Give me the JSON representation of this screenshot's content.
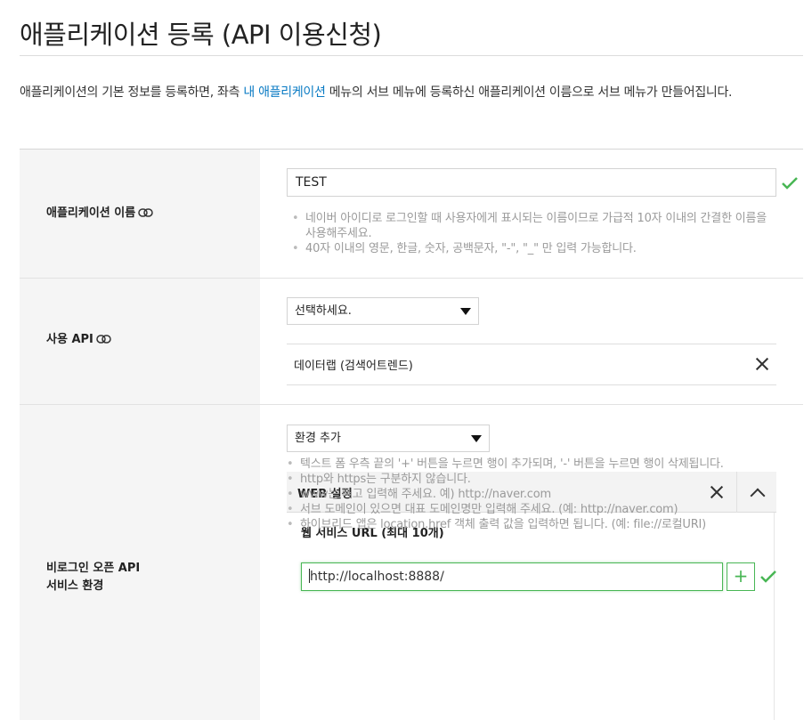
{
  "page": {
    "title": "애플리케이션 등록 (API 이용신청)",
    "description_before": "애플리케이션의 기본 정보를 등록하면, 좌측 ",
    "description_link": "내 애플리케이션",
    "description_after": " 메뉴의 서브 메뉴에 등록하신 애플리케이션 이름으로 서브 메뉴가 만들어집니다."
  },
  "app_name": {
    "label": "애플리케이션 이름",
    "value": "TEST",
    "hints": [
      "네이버 아이디로 로그인할 때 사용자에게 표시되는 이름이므로 가급적 10자 이내의 간결한 이름을 사용해주세요.",
      "40자 이내의 영문, 한글, 숫자, 공백문자, \"-\", \"_\" 만 입력 가능합니다."
    ]
  },
  "use_api": {
    "label": "사용 API",
    "select_value": "선택하세요.",
    "items": [
      "데이터랩 (검색어트렌드)"
    ]
  },
  "service_env": {
    "label_line1": "비로그인 오픈 API",
    "label_line2": "서비스 환경",
    "select_value": "환경 추가",
    "web": {
      "title": "WEB 설정",
      "url_label": "웹 서비스 URL (최대 10개)",
      "url_value": "http://localhost:8888/",
      "add_label": "+",
      "hints": [
        "텍스트 폼 우측 끝의 '+' 버튼을 누르면 행이 추가되며, '-' 버튼을 누르면 행이 삭제됩니다.",
        "http와 https는 구분하지 않습니다.",
        "www는 빼고 입력해 주세요. 예) http://naver.com",
        "서브 도메인이 있으면 대표 도메인명만 입력해 주세요. (예: http://naver.com)",
        "하이브리드 앱은 location.href 객체 출력 값을 입력하면 됩니다. (예: file://로컬URI)"
      ]
    }
  },
  "colors": {
    "accent_green": "#48b654",
    "link_blue": "#0a7bc4"
  }
}
